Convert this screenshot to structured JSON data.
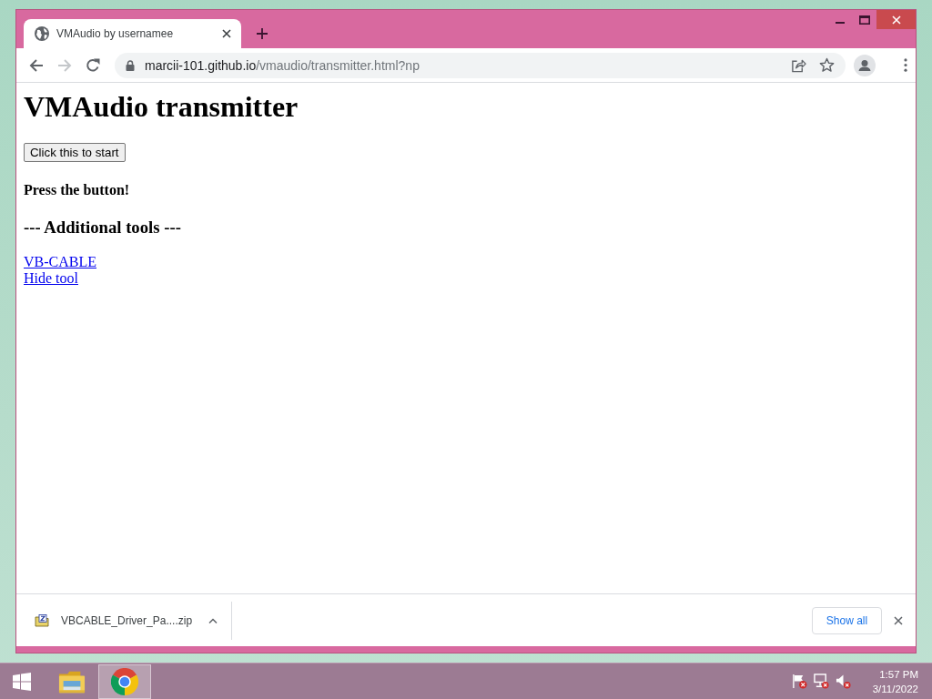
{
  "tabs": [
    {
      "title": "VMAudio by usernamee",
      "selected": true
    }
  ],
  "toolbar": {
    "nav_buttons": [
      {
        "kind": "back",
        "disabled": false
      },
      {
        "kind": "forward",
        "disabled": true
      },
      {
        "kind": "reload",
        "disabled": false
      }
    ],
    "url": {
      "host": "marcii-101.github.io",
      "path": "/vmaudio/transmitter.html?np"
    }
  },
  "page": {
    "heading": "VMAudio transmitter",
    "start_button": "Click this to start",
    "status": "Press the button!",
    "section_heading": "--- Additional tools ---",
    "links": [
      "VB-CABLE",
      "Hide tool"
    ]
  },
  "downloads": {
    "items": [
      {
        "file_name": "VBCABLE_Driver_Pa....zip"
      }
    ],
    "show_all": "Show all"
  },
  "taskbar": {
    "apps": [
      {
        "kind": "explorer",
        "selected": false
      },
      {
        "kind": "chrome",
        "selected": true
      }
    ],
    "clock": {
      "time": "1:57 PM",
      "date": "3/11/2022"
    }
  }
}
